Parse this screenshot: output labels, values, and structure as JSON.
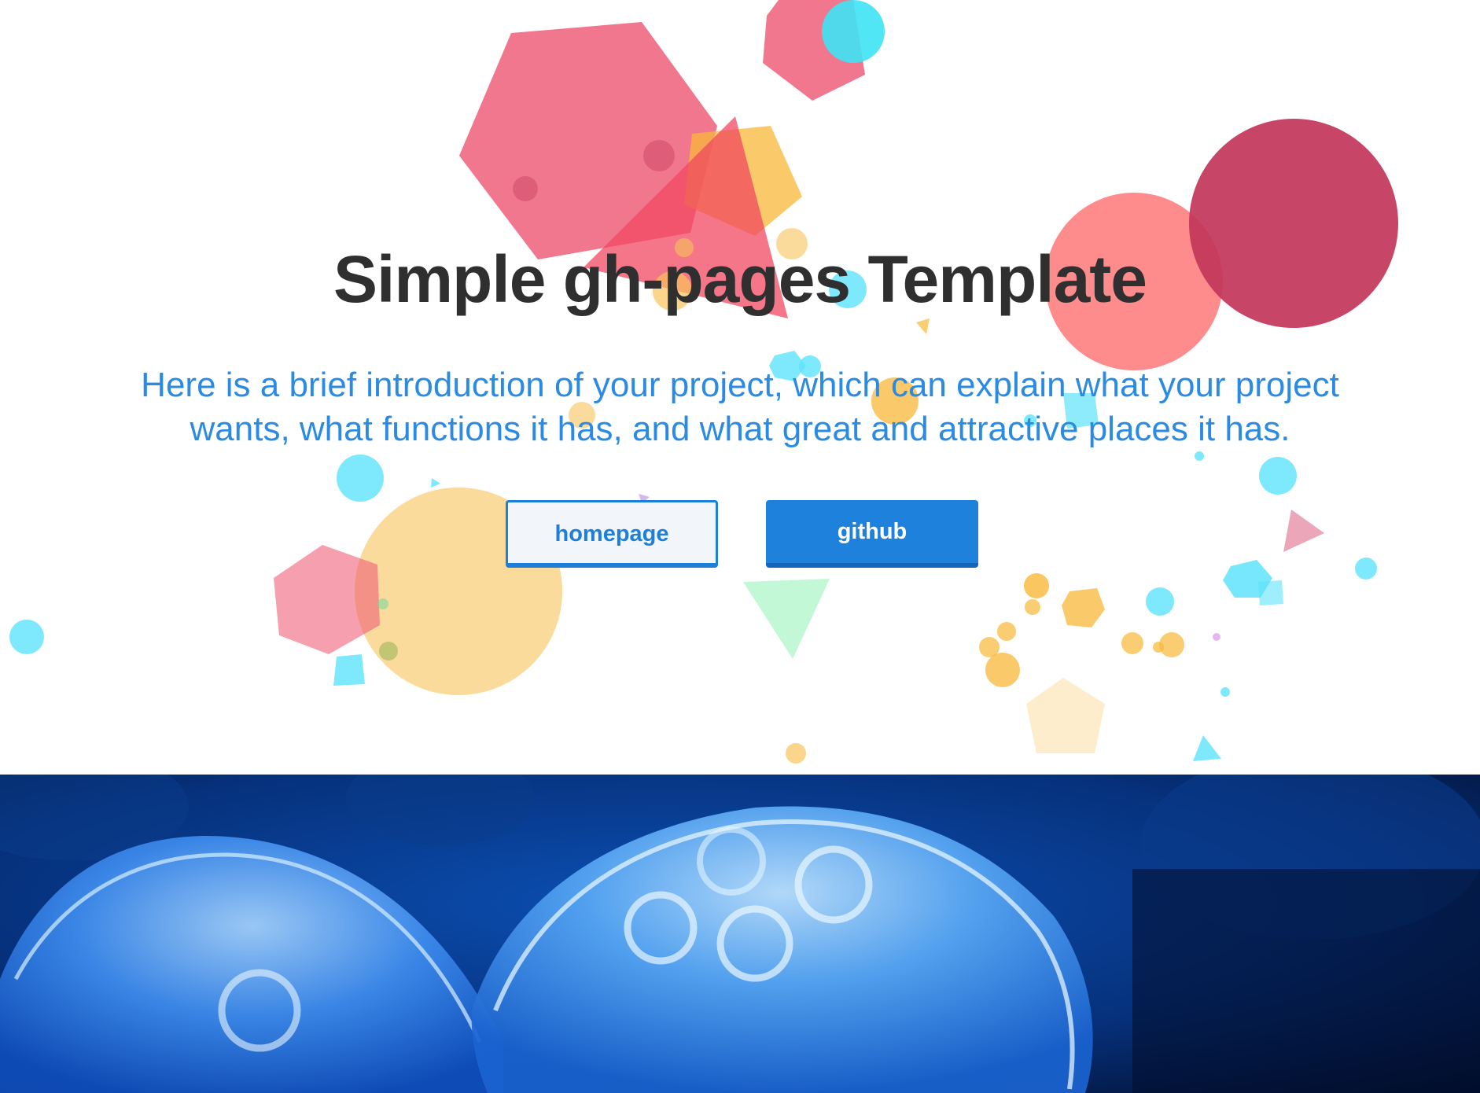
{
  "hero": {
    "title": "Simple gh-pages Template",
    "intro": "Here is a brief introduction of your project, which can explain what your project wants, what functions it has, and what great and attractive places it has.",
    "buttons": {
      "homepage_label": "homepage",
      "github_label": "github"
    }
  },
  "colors": {
    "accent_blue": "#1e82dd",
    "intro_text": "#2b8be3",
    "title_text": "#2f2f2f",
    "shape_pink": "#ef5f7a",
    "shape_crimson": "#c2365a",
    "shape_salmon": "#ff7f80",
    "shape_orange": "#f8c35a",
    "shape_cyan": "#5ee3fb",
    "shape_green": "#b8f7cf",
    "banner_bg": "#041a45"
  },
  "banner": {
    "image_subject": "jellyfish-photo"
  }
}
